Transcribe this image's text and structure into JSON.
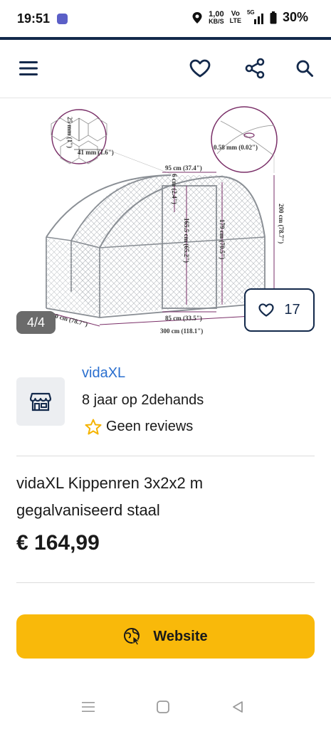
{
  "status_bar": {
    "time": "19:51",
    "net_speed_value": "1,00",
    "net_speed_unit": "KB/S",
    "volte_top": "Vo",
    "volte_bottom": "LTE",
    "signal_label": "5G",
    "battery": "30%"
  },
  "header": {
    "menu_icon": "hamburger-icon",
    "favorite_icon": "heart-icon",
    "share_icon": "share-icon",
    "search_icon": "search-icon"
  },
  "gallery": {
    "counter": "4/4",
    "likes": "17",
    "diagram_labels": {
      "mesh_height": "25 mm (1\")",
      "mesh_width": "41 mm (1.6\")",
      "wire": "0.58 mm (0.02\")",
      "door_width": "95 cm (37.4\")",
      "door_gap": "6 cm (2.4\")",
      "door_height": "165.5 cm (65.2\")",
      "side_height": "179 cm (70.5\")",
      "total_height": "200 cm (78.7\")",
      "depth": "200 cm (78.7\")",
      "door_bottom": "85 cm (33.5\")",
      "length": "300 cm (118.1\")"
    }
  },
  "seller": {
    "name": "vidaXL",
    "since": "8 jaar op 2dehands",
    "reviews": "Geen reviews"
  },
  "product": {
    "title": "vidaXL Kippenren 3x2x2 m gegalvaniseerd staal",
    "price": "€ 164,99"
  },
  "cta": {
    "website_label": "Website"
  },
  "colors": {
    "brand_navy": "#13294b",
    "accent_yellow": "#f9b90a",
    "link_blue": "#2a6fcf"
  }
}
